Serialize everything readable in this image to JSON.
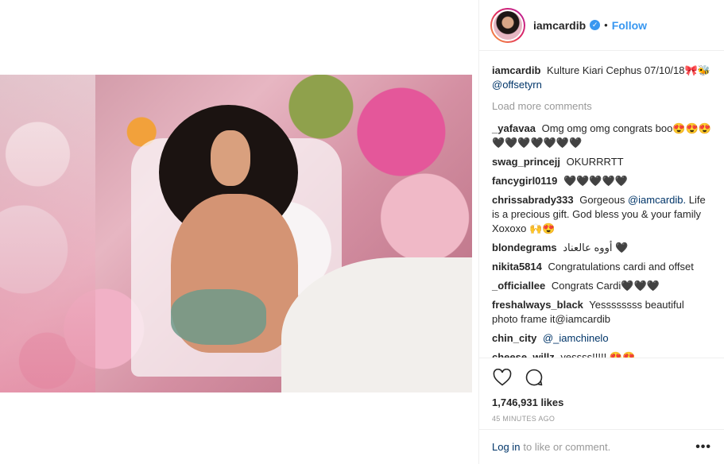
{
  "post": {
    "username": "iamcardib",
    "follow_label": "Follow",
    "dot": "•",
    "verified_glyph": "✓"
  },
  "caption": {
    "user": "iamcardib",
    "text": "Kulture Kiari Cephus 07/10/18🎀🐝",
    "mention": "@offsetyrn"
  },
  "load_more": "Load more comments",
  "comments": [
    {
      "user": "_yafavaa",
      "text": "Omg omg omg congrats boo😍😍😍🖤🖤🖤🖤🖤🖤🖤"
    },
    {
      "user": "swag_princejj",
      "text": "OKURRRTT"
    },
    {
      "user": "fancygirl0119",
      "text": "🖤🖤🖤🖤🖤"
    },
    {
      "user": "chrissabrady333",
      "text_pre": "Gorgeous",
      "mention": "@iamcardib.",
      "text_post": "Life is a precious gift. God bless you & your family Xoxoxo 🙌😍"
    },
    {
      "user": "blondegrams",
      "text": "أووه عالعناد 🖤"
    },
    {
      "user": "nikita5814",
      "text": "Congratulations cardi and offset"
    },
    {
      "user": "_officiallee",
      "text": "Congrats Cardi🖤🖤🖤"
    },
    {
      "user": "freshalways_black",
      "text": "Yessssssss beautiful photo frame it@iamcardib"
    },
    {
      "user": "chin_city",
      "mention": "@_iamchinelo"
    },
    {
      "user": "cheese_willz",
      "text": "yessss!!!!! 😍😍"
    }
  ],
  "likes": "1,746,931 likes",
  "time": "45 MINUTES AGO",
  "login": {
    "link": "Log in",
    "text": "to like or comment.",
    "more": "•••"
  },
  "icons": {
    "like": "heart-icon",
    "comment": "comment-icon",
    "verified": "verified-badge-icon",
    "more": "more-options-icon"
  },
  "colors": {
    "link_blue": "#3897f0",
    "mention_blue": "#003569",
    "muted_gray": "#999999",
    "text": "#262626"
  }
}
